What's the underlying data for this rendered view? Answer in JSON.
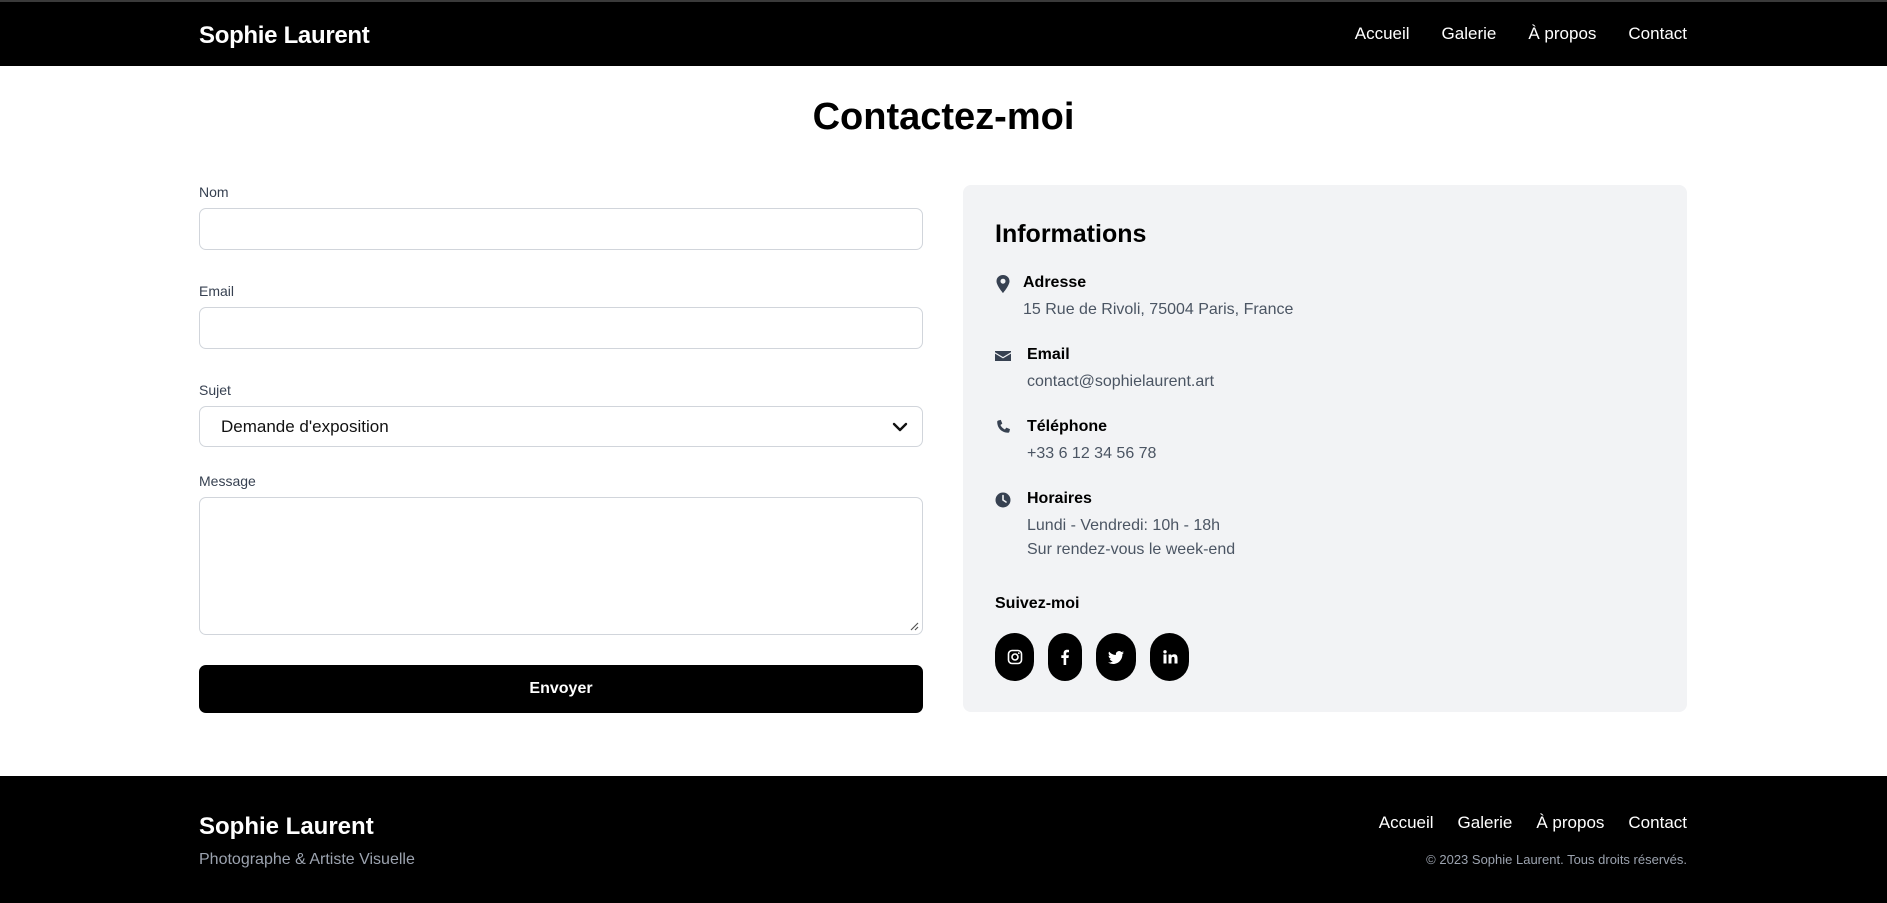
{
  "header": {
    "brand": "Sophie Laurent",
    "nav": [
      "Accueil",
      "Galerie",
      "À propos",
      "Contact"
    ]
  },
  "main": {
    "title": "Contactez-moi"
  },
  "form": {
    "name_label": "Nom",
    "name_value": "",
    "email_label": "Email",
    "email_value": "",
    "subject_label": "Sujet",
    "subject_selected": "Demande d'exposition",
    "message_label": "Message",
    "message_value": "",
    "submit_label": "Envoyer"
  },
  "info": {
    "heading": "Informations",
    "address_title": "Adresse",
    "address_value": "15 Rue de Rivoli, 75004 Paris, France",
    "email_title": "Email",
    "email_value": "contact@sophielaurent.art",
    "phone_title": "Téléphone",
    "phone_value": "+33 6 12 34 56 78",
    "hours_title": "Horaires",
    "hours_line1": "Lundi - Vendredi: 10h - 18h",
    "hours_line2": "Sur rendez-vous le week-end",
    "follow_label": "Suivez-moi",
    "socials": [
      "instagram-icon",
      "facebook-icon",
      "twitter-icon",
      "linkedin-icon"
    ],
    "icon_color": "#374151"
  },
  "footer": {
    "brand": "Sophie Laurent",
    "tagline": "Photographe & Artiste Visuelle",
    "nav": [
      "Accueil",
      "Galerie",
      "À propos",
      "Contact"
    ],
    "copyright": "© 2023 Sophie Laurent. Tous droits réservés."
  },
  "colors": {
    "header_bg": "#000000",
    "card_bg": "#f2f3f5",
    "button_bg": "#000000",
    "muted_text": "#4b5563"
  }
}
